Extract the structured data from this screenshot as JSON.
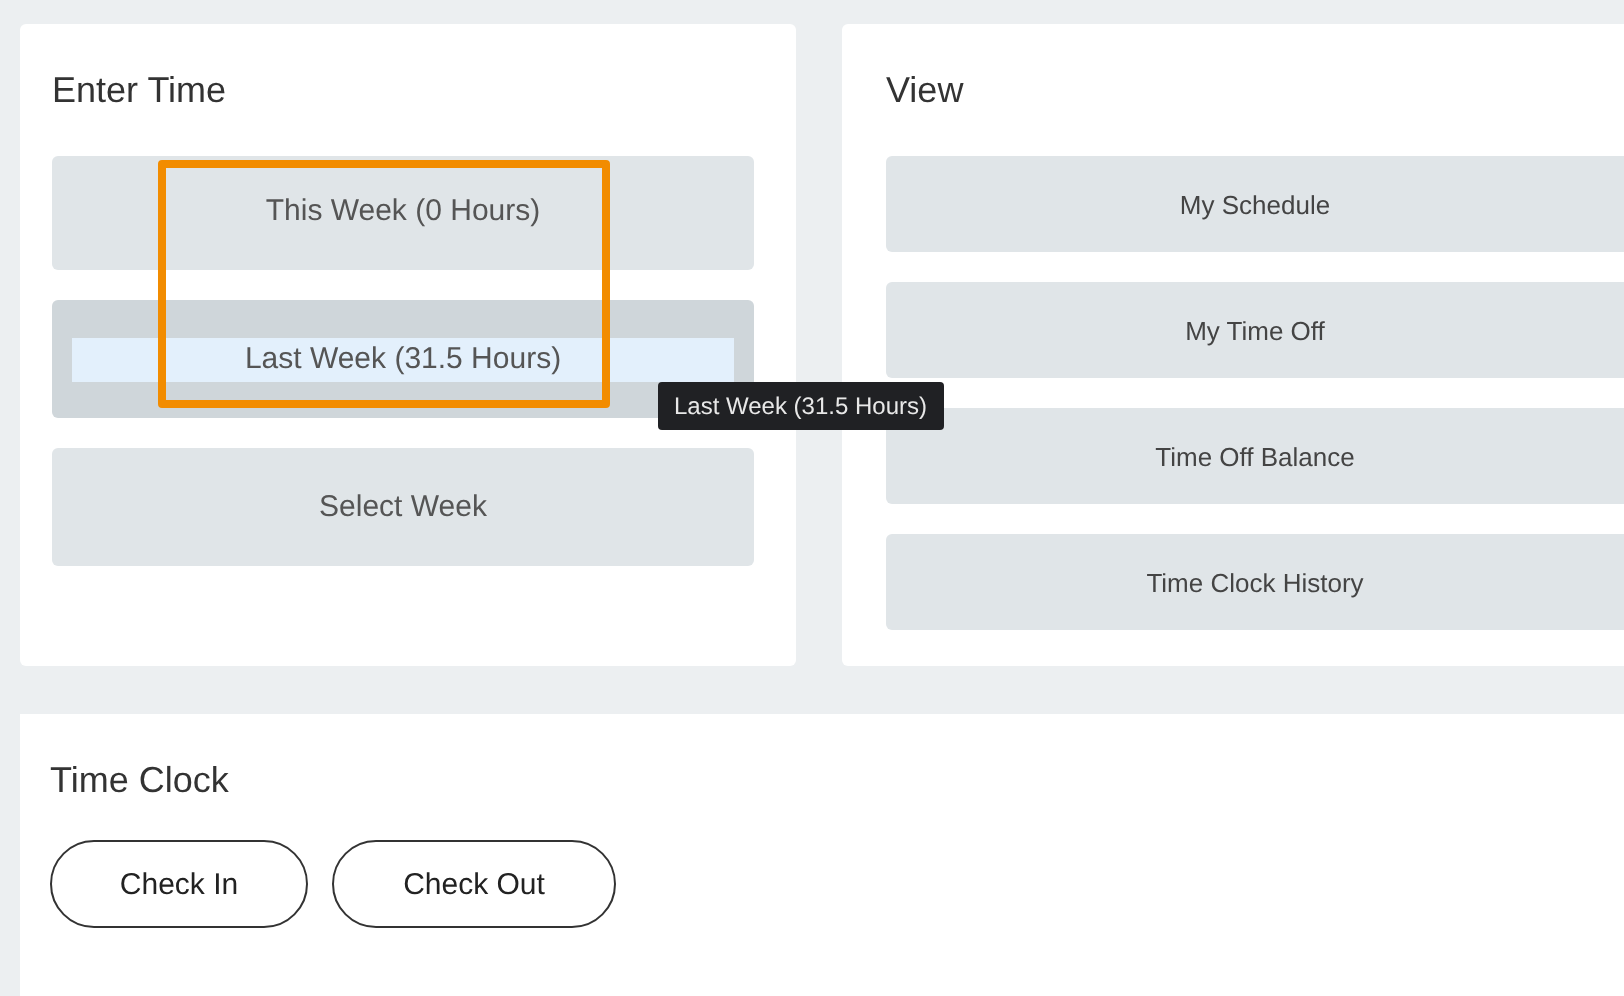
{
  "enter_time": {
    "title": "Enter Time",
    "buttons": [
      {
        "label": "This Week (0 Hours)",
        "hovered": false
      },
      {
        "label": "Last Week (31.5 Hours)",
        "hovered": true
      },
      {
        "label": "Select Week",
        "hovered": false
      }
    ]
  },
  "tooltip": "Last Week (31.5 Hours)",
  "view": {
    "title": "View",
    "buttons": [
      {
        "label": "My Schedule",
        "hovered": false
      },
      {
        "label": "My Time Off",
        "hovered": false
      },
      {
        "label": "Time Off Balance",
        "hovered": false
      },
      {
        "label": "Time Clock History",
        "hovered": false
      }
    ]
  },
  "time_clock": {
    "title": "Time Clock",
    "buttons": [
      "Check In",
      "Check Out"
    ]
  }
}
